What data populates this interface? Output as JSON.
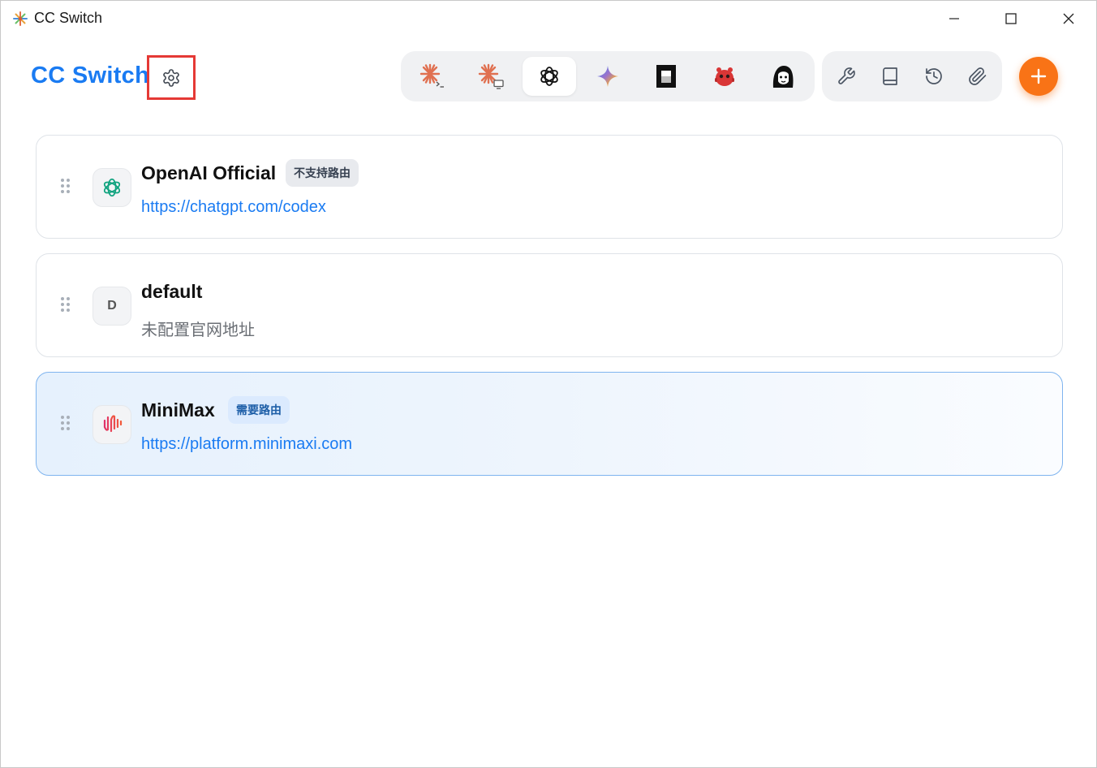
{
  "window": {
    "title": "CC Switch",
    "controls": [
      "minimize-icon",
      "maximize-icon",
      "close-icon"
    ]
  },
  "header": {
    "brand": "CC Switch",
    "settings_icon": "gear-icon",
    "app_tabs": [
      {
        "id": "claude-code",
        "icon": "claude-terminal-icon",
        "active": false
      },
      {
        "id": "claude-desktop",
        "icon": "claude-desktop-icon",
        "active": false
      },
      {
        "id": "codex",
        "icon": "openai-icon",
        "active": true
      },
      {
        "id": "gemini",
        "icon": "gemini-icon",
        "active": false
      },
      {
        "id": "opencode",
        "icon": "opencode-icon",
        "active": false
      },
      {
        "id": "red-bot",
        "icon": "red-robot-icon",
        "active": false
      },
      {
        "id": "avatar-app",
        "icon": "character-icon",
        "active": false
      }
    ],
    "tools": [
      "wrench-icon",
      "book-icon",
      "history-icon",
      "paperclip-icon"
    ],
    "add_icon": "plus-icon"
  },
  "providers": [
    {
      "name": "OpenAI Official",
      "badge": "不支持路由",
      "badge_style": "gray",
      "url": "https://chatgpt.com/codex",
      "avatar": "openai-icon",
      "active": false
    },
    {
      "name": "default",
      "avatar_letter": "D",
      "url": "未配置官网地址",
      "url_muted": true,
      "active": false
    },
    {
      "name": "MiniMax",
      "badge": "需要路由",
      "badge_style": "blue",
      "url": "https://platform.minimaxi.com",
      "avatar": "minimax-icon",
      "active": true
    }
  ],
  "colors": {
    "brand": "#1a7bf2",
    "accent": "#f97316",
    "link": "#1a7bf2",
    "highlight": "#e53935"
  }
}
